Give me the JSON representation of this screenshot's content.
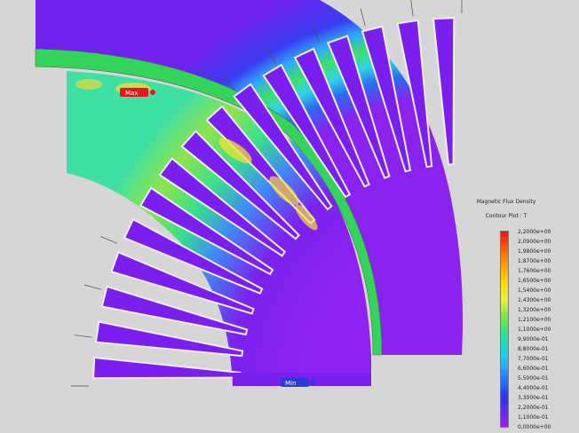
{
  "legend": {
    "title": "Magnetic Flux Density",
    "subtitle": "Contour Plot : T",
    "ticks": [
      "2,2000e+00",
      "2,0900e+00",
      "1,9800e+00",
      "1,8700e+00",
      "1,7600e+00",
      "1,6500e+00",
      "1,5400e+00",
      "1,4300e+00",
      "1,3200e+00",
      "1,2100e+00",
      "1,1000e+00",
      "9,9000e-01",
      "8,8000e-01",
      "7,7000e-01",
      "6,6000e-01",
      "5,5000e-01",
      "4,4000e-01",
      "3,3000e-01",
      "2,2000e-01",
      "1,1000e-01",
      "0,0000e+00"
    ],
    "colors": [
      "#ff1a1a",
      "#ff6a00",
      "#ffb000",
      "#f2ea2a",
      "#a8f03a",
      "#3fe05a",
      "#19e0c8",
      "#2a8bff",
      "#2b2df0",
      "#6a20e0",
      "#a020f0"
    ]
  },
  "markers": {
    "max": {
      "label": "Max",
      "color": "#e8141e"
    },
    "min": {
      "label": "Min",
      "color": "#2a3cd8"
    }
  },
  "colors": {
    "background": "#d6d6d6",
    "yoke_outer": "#6f22ee",
    "stator_body": "#33c8f0",
    "tooth_mid": "#36dc6a",
    "tooth_high": "#f0e23a",
    "slot": "#7a1ff0",
    "air": "#e6e6e6",
    "rotor": "#8c22f0"
  }
}
